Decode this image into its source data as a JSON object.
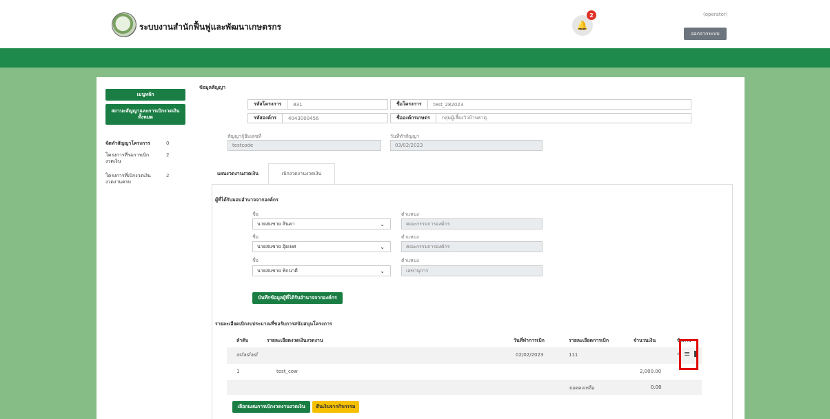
{
  "header": {
    "brand": "ระบบงานสำนักฟื้นฟูและพัฒนาเกษตรกร",
    "notification_count": "2",
    "user_role": "(operator)",
    "logout_label": "ออกจากระบบ"
  },
  "sidebar": {
    "menu_label": "เมนูหลัก",
    "status_label": "สถานะสัญญาและการเบิกงวดเงิน\nทั้งหมด",
    "stats": [
      {
        "label": "จัดทำสัญญาโครงการ",
        "count": "0"
      },
      {
        "label": "โครงการที่รอการเบิก\nงวดเงิน",
        "count": "2"
      },
      {
        "label": "โครงการที่เบิกงวดเงิน\nงวดงานครบ",
        "count": "2"
      }
    ]
  },
  "contract": {
    "section_title": "ข้อมูลสัญญา",
    "project_code_label": "รหัสโครงการ",
    "project_code": "831",
    "project_name_label": "ชื่อโครงการ",
    "project_name": "test_282023",
    "org_code_label": "รหัสองค์กร",
    "org_code": "4043000456",
    "org_name_label": "ชื่อองค์กรเกษตร",
    "org_name": "กลุ่มผู้เลี้ยงวัวบ้านธาตุ",
    "loan_no_label": "สัญญากู้ยืมเลขที่",
    "loan_no": "testcode",
    "contract_date_label": "วันที่ทำสัญญา",
    "contract_date": "03/02/2023"
  },
  "tabs": [
    {
      "label": "แผนงวดงานงวดเงิน"
    },
    {
      "label": "เบิกงวดงานงวดเงิน"
    }
  ],
  "authorized": {
    "title": "ผู้ที่ได้รับมอบอำนาจจากองค์กร",
    "name_label": "ชื่อ",
    "position_label": "ตำแหน่ง",
    "people": [
      {
        "name": "นายสมชาย สินคา",
        "position": "คณะกรรมการองค์กร"
      },
      {
        "name": "นายสมชาย อุ้ยเทศ",
        "position": "คณะกรรมการองค์กร"
      },
      {
        "name": "นายสมชาย พิกนาดี",
        "position": "เลขานุการ"
      }
    ],
    "save_label": "บันทึกข้อมูลผู้ที่ได้รับอำนาจจากองค์กร"
  },
  "budget": {
    "title": "รายละเอียดเบิกงบประมาณที่ขอรับการสนับสนุนโครงการ",
    "headers": [
      "ลำดับ",
      "รายละเอียดงวดเงินงวดงาน",
      "วันที่ทำการเบิก",
      "รายละเอียดการเบิก",
      "จำนวนเงิน",
      "จัดการ"
    ],
    "group_row": {
      "name": "asfasfasf",
      "date": "02/02/2023",
      "detail": "111"
    },
    "item_row": {
      "no": "1",
      "desc": "test_cow",
      "amount": "2,000.00"
    },
    "balance_label": "ยอดคงเหลือ",
    "balance": "0.00"
  },
  "actions": {
    "select_plan_label": "เลือกแผนการเบิกงวดงานงวดเงิน",
    "back_label": "ดีนเงินจากกิจกรรม"
  }
}
